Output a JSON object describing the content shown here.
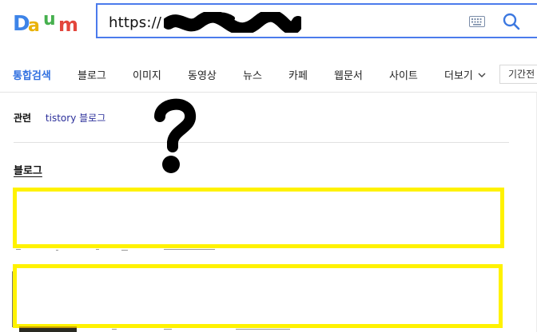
{
  "brand": {
    "logo_text": "Daum",
    "logo_letters": [
      "D",
      "a",
      "u",
      "m"
    ],
    "logo_colors": [
      "#3d84e8",
      "#e9b208",
      "#46b04e",
      "#e3463c"
    ]
  },
  "search": {
    "url_prefix": "https://",
    "keyboard_icon": "keyboard-icon",
    "search_icon": "search-icon",
    "border_color": "#4b7bec"
  },
  "tabs": [
    {
      "label": "통합검색",
      "active": true
    },
    {
      "label": "블로그",
      "active": false
    },
    {
      "label": "이미지",
      "active": false
    },
    {
      "label": "동영상",
      "active": false
    },
    {
      "label": "뉴스",
      "active": false
    },
    {
      "label": "카페",
      "active": false
    },
    {
      "label": "웹문서",
      "active": false
    },
    {
      "label": "사이트",
      "active": false
    },
    {
      "label": "더보기",
      "active": false
    }
  ],
  "period_button": "기간전",
  "related": {
    "label": "관련",
    "link": "tistory 블로그"
  },
  "section": {
    "title": "블로그"
  },
  "annotation": {
    "mark": "?"
  },
  "colors": {
    "active_tab": "#3070e0",
    "highlight": "#fff200",
    "link": "#2b2f9a"
  }
}
